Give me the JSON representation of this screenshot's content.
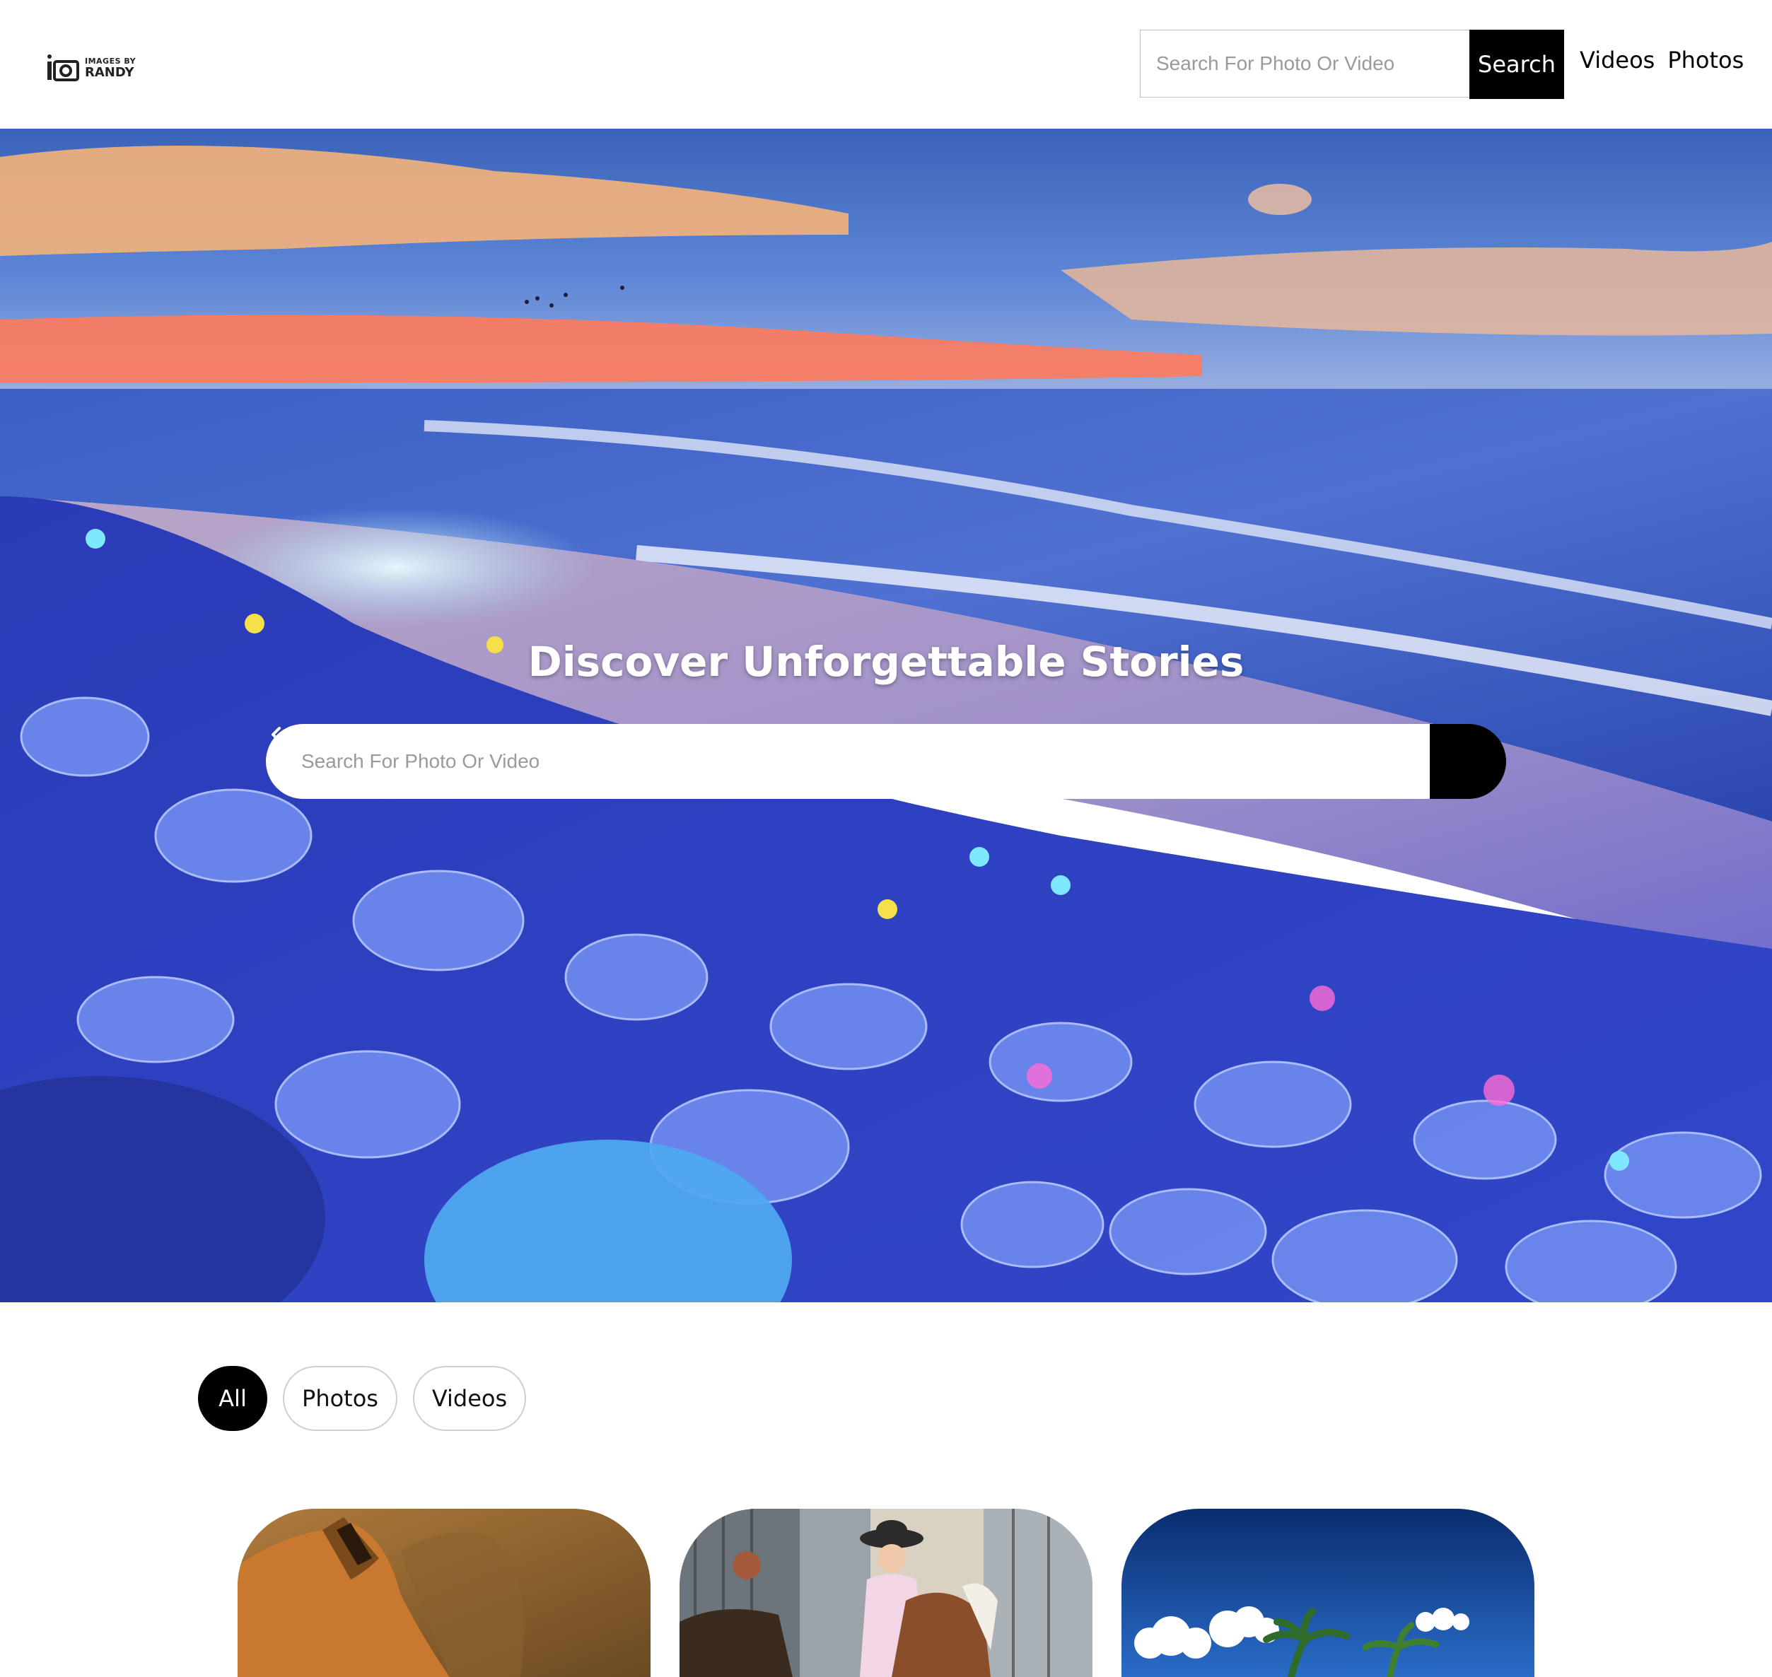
{
  "header": {
    "logo": {
      "line1": "IMAGES BY",
      "line2": "RANDY",
      "icon": "camera-icon"
    },
    "search": {
      "placeholder": "Search For Photo Or Video",
      "button_label": "Search"
    },
    "nav": [
      {
        "label": "Videos"
      },
      {
        "label": "Photos"
      }
    ]
  },
  "hero": {
    "title": "Discover Unforgettable Stories",
    "search": {
      "placeholder": "Search For Photo Or Video",
      "button_icon": "chevron-left-icon"
    }
  },
  "filters": [
    {
      "label": "All",
      "active": true
    },
    {
      "label": "Photos",
      "active": false
    },
    {
      "label": "Videos",
      "active": false
    }
  ],
  "gallery": [
    {
      "subject": "fox"
    },
    {
      "subject": "cowboy-on-horse"
    },
    {
      "subject": "palm-trees"
    }
  ],
  "colors": {
    "button_bg": "#000000",
    "page_bg": "#ffffff",
    "text": "#000000"
  }
}
